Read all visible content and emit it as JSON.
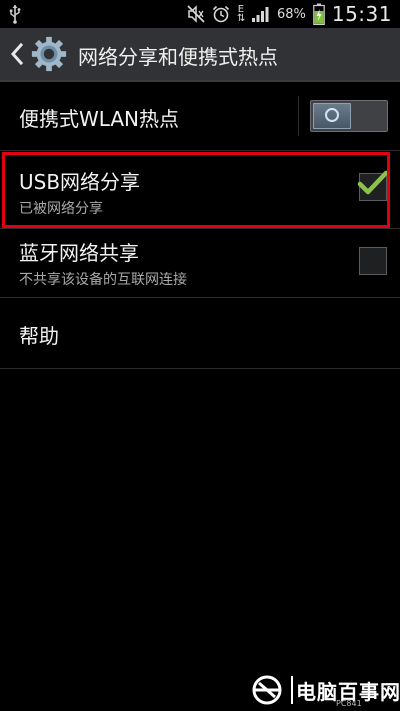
{
  "status_bar": {
    "battery_percent": "68%",
    "time": "15:31",
    "network_type": "E",
    "icons": [
      "usb-icon",
      "mute-icon",
      "alarm-icon",
      "signal-icon",
      "battery-charging-icon"
    ]
  },
  "action_bar": {
    "title": "网络分享和便携式热点",
    "back_icon": "back-icon",
    "app_icon": "settings-gear-icon"
  },
  "settings": [
    {
      "title": "便携式WLAN热点",
      "subtitle": "",
      "control": "toggle",
      "state": "off"
    },
    {
      "title": "USB网络分享",
      "subtitle": "已被网络分享",
      "control": "checkbox",
      "state": "checked",
      "highlighted": true
    },
    {
      "title": "蓝牙网络共享",
      "subtitle": "不共享该设备的互联网连接",
      "control": "checkbox",
      "state": "unchecked"
    },
    {
      "title": "帮助",
      "subtitle": "",
      "control": "none"
    }
  ],
  "colors": {
    "action_bar_bg": "#303235",
    "highlight_border": "#e0000f",
    "check_color": "#8bc34a",
    "toggle_ring": "#cfe4f5"
  },
  "watermark": {
    "text": "电脑百事网",
    "small_text": "PC841"
  }
}
